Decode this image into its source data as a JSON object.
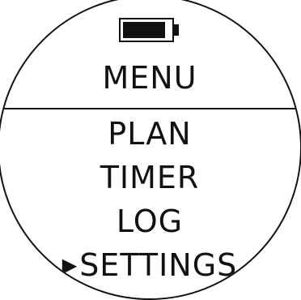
{
  "device": {
    "battery_level": 0.9,
    "fg_color": "#111111",
    "bg_color": "#ffffff"
  },
  "menu": {
    "title": "MENU",
    "cursor_icon": "triangle-right-icon",
    "cursor_glyph": "▶",
    "items": [
      {
        "label": "PLAN",
        "selected": false
      },
      {
        "label": "TIMER",
        "selected": false
      },
      {
        "label": "LOG",
        "selected": false
      },
      {
        "label": "SETTINGS",
        "selected": true
      }
    ]
  }
}
